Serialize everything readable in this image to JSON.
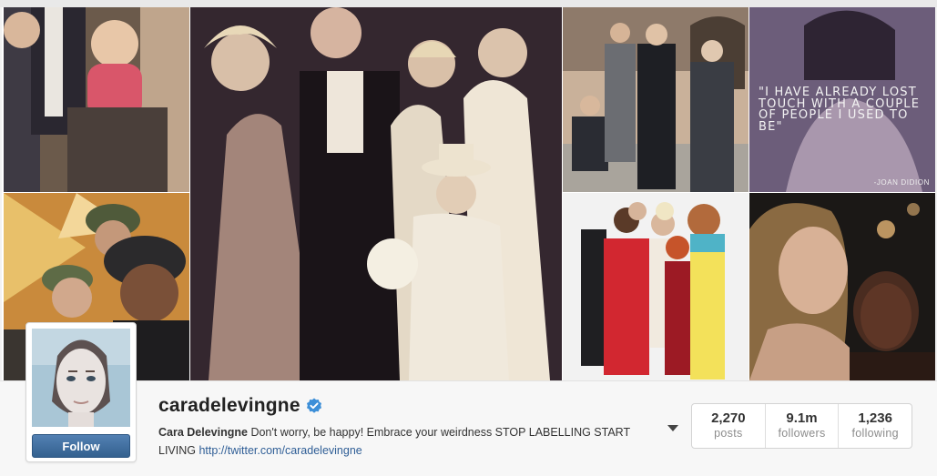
{
  "profile": {
    "username": "caradelevingne",
    "full_name": "Cara Delevingne",
    "bio_text": " Don't worry, be happy! Embrace your weirdness STOP LABELLING START LIVING ",
    "link": "http://twitter.com/caradelevingne",
    "follow_label": "Follow",
    "verified": true
  },
  "stats": [
    {
      "value": "2,270",
      "label": "posts"
    },
    {
      "value": "9.1m",
      "label": "followers"
    },
    {
      "value": "1,236",
      "label": "following"
    }
  ],
  "photos": {
    "quote_text": "\"I have already lost touch with a couple of people I used to be\"",
    "quote_author": "-JOAN DIDION"
  },
  "colors": {
    "follow_button": "#3b6a9c",
    "link": "#2f5e96",
    "verified_badge": "#3d8fd8"
  },
  "icons": [
    "verified-badge-icon",
    "dropdown-caret-icon"
  ]
}
